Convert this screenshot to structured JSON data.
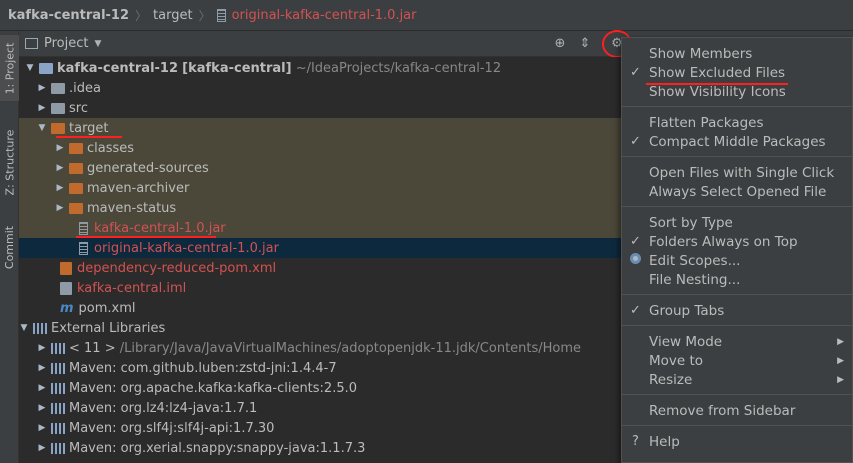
{
  "breadcrumb": {
    "project": "kafka-central-12",
    "folder": "target",
    "file": "original-kafka-central-1.0.jar"
  },
  "stripe": {
    "project_tab": "1: Project",
    "structure_tab": "Z: Structure",
    "commit_tab": "Commit"
  },
  "panel": {
    "title": "Project"
  },
  "tree": {
    "root_name": "kafka-central-12",
    "root_module": "[kafka-central]",
    "root_path": "~/IdeaProjects/kafka-central-12",
    "idea": ".idea",
    "src": "src",
    "target": "target",
    "classes": "classes",
    "generated_sources": "generated-sources",
    "maven_archiver": "maven-archiver",
    "maven_status": "maven-status",
    "jar": "kafka-central-1.0.jar",
    "original_jar": "original-kafka-central-1.0.jar",
    "dep_pom": "dependency-reduced-pom.xml",
    "iml": "kafka-central.iml",
    "pom": "pom.xml",
    "external_libraries": "External Libraries",
    "jdk_name": "< 11 >",
    "jdk_path": "/Library/Java/JavaVirtualMachines/adoptopenjdk-11.jdk/Contents/Home",
    "libs": [
      "Maven: com.github.luben:zstd-jni:1.4.4-7",
      "Maven: org.apache.kafka:kafka-clients:2.5.0",
      "Maven: org.lz4:lz4-java:1.7.1",
      "Maven: org.slf4j:slf4j-api:1.7.30",
      "Maven: org.xerial.snappy:snappy-java:1.1.7.3"
    ]
  },
  "menu": {
    "show_members": "Show Members",
    "show_excluded": "Show Excluded Files",
    "show_visibility": "Show Visibility Icons",
    "flatten": "Flatten Packages",
    "compact": "Compact Middle Packages",
    "open_single": "Open Files with Single Click",
    "always_select": "Always Select Opened File",
    "sort_type": "Sort by Type",
    "folders_top": "Folders Always on Top",
    "edit_scopes": "Edit Scopes...",
    "file_nesting": "File Nesting...",
    "group_tabs": "Group Tabs",
    "view_mode": "View Mode",
    "move_to": "Move to",
    "resize": "Resize",
    "remove_sidebar": "Remove from Sidebar",
    "help": "Help",
    "check_glyph": "✓",
    "help_glyph": "?"
  },
  "colors": {
    "excluded_bg": "#4b483a",
    "selected_bg": "#0d293e",
    "highlight_red": "#ff1f1f",
    "excluded_text": "#d25252"
  }
}
